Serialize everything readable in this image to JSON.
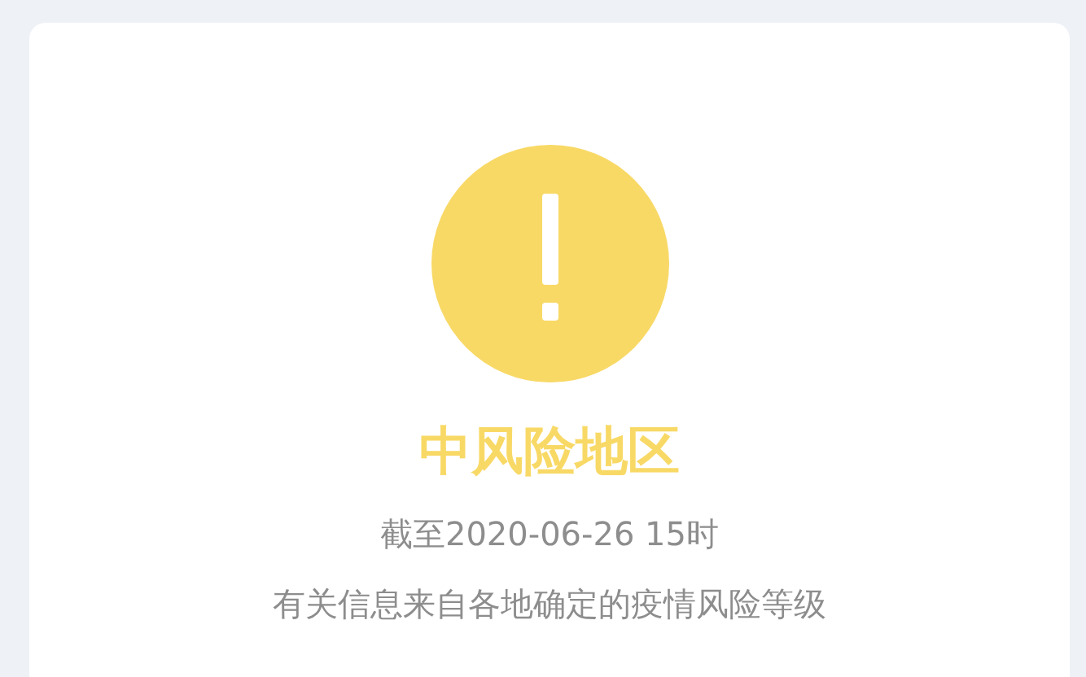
{
  "risk": {
    "kind": "medium",
    "title": "中风险地区",
    "updated": "截至2020-06-26 15时",
    "note": "有关信息来自各地确定的疫情风险等级"
  }
}
